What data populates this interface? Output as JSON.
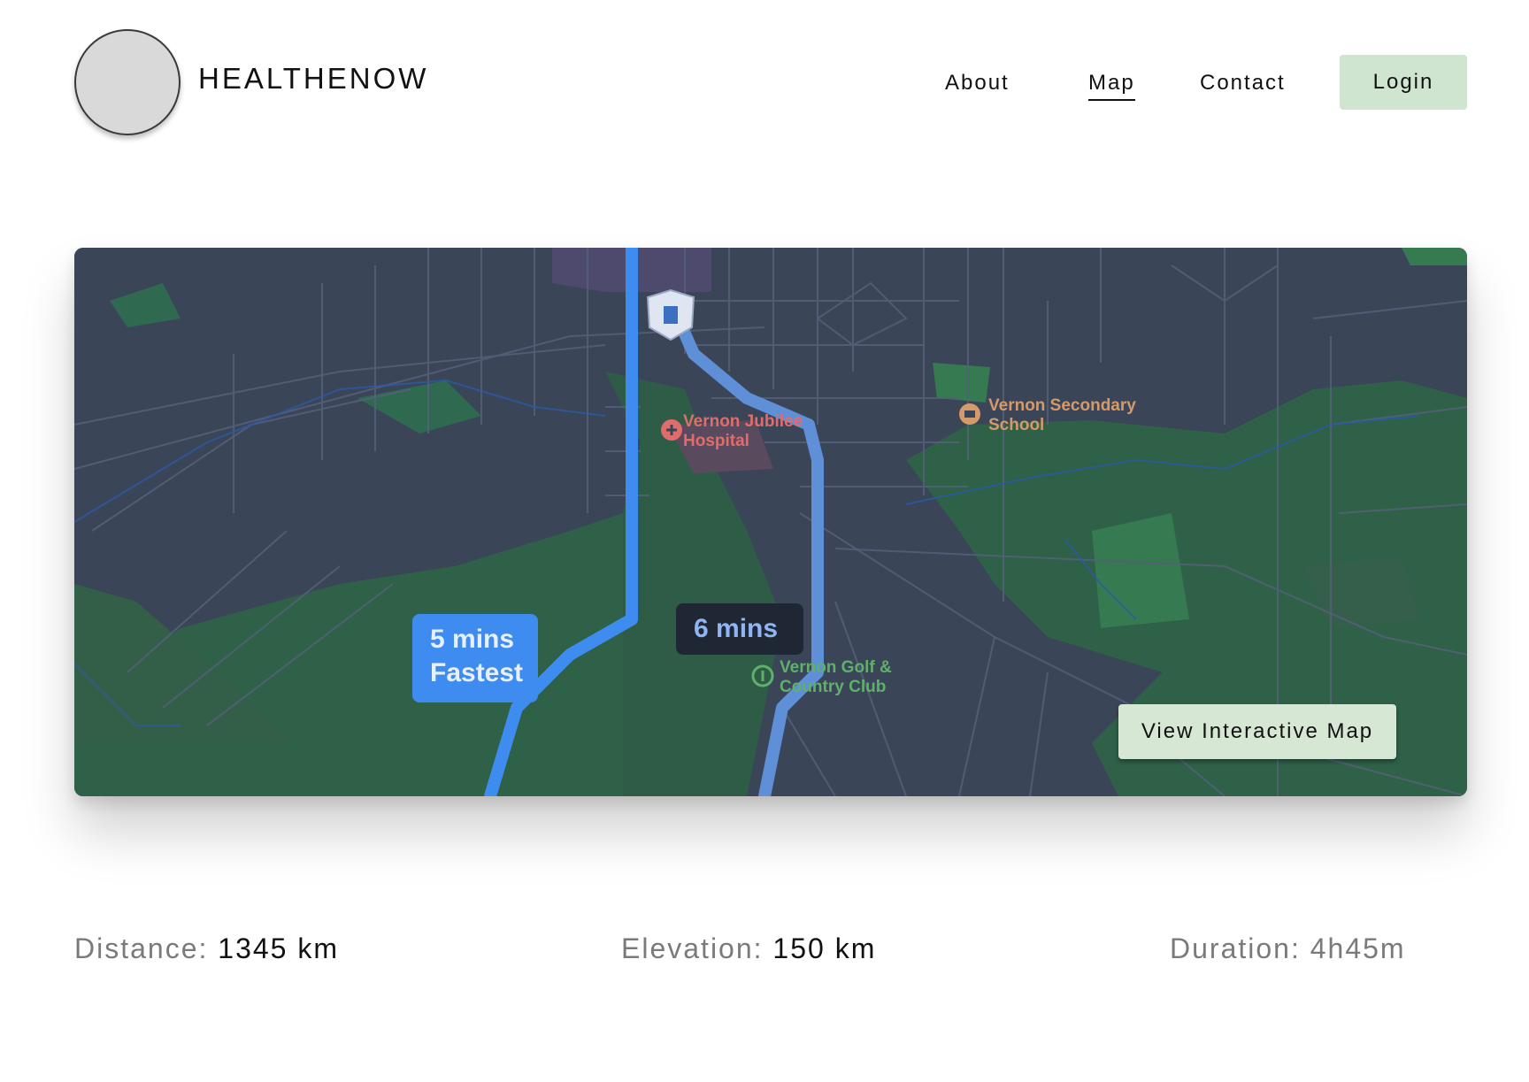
{
  "header": {
    "brand": "HEALTHENOW",
    "nav": {
      "about": "About",
      "map": "Map",
      "contact": "Contact",
      "login": "Login"
    }
  },
  "map": {
    "route_fastest": {
      "time": "5 mins",
      "tag": "Fastest"
    },
    "route_alt": {
      "time": "6 mins"
    },
    "pois": {
      "hospital": [
        "Vernon Jubilee",
        "Hospital"
      ],
      "school": [
        "Vernon Secondary",
        "School"
      ],
      "golf": [
        "Vernon Golf &",
        "Country Club"
      ]
    },
    "view_button": "View Interactive Map",
    "colors": {
      "background": "#3b4558",
      "park": "#2f6048",
      "route_primary": "#3f8cf0",
      "route_secondary": "#5f8fd6"
    }
  },
  "stats": {
    "distance": {
      "label": "Distance:",
      "value": "1345 km"
    },
    "elevation": {
      "label": "Elevation:",
      "value": "150 km"
    },
    "duration": {
      "label": "Duration:",
      "value": "4h45m"
    }
  }
}
